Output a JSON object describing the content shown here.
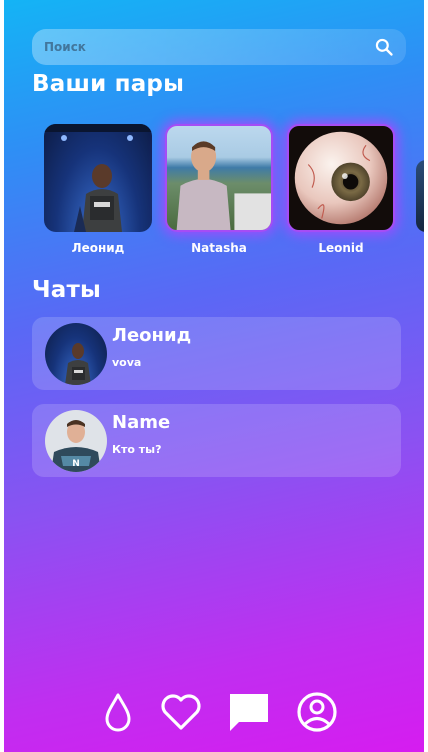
{
  "search": {
    "placeholder": "Поиск",
    "value": "",
    "icon": "search-icon"
  },
  "matches": {
    "title": "Ваши пары",
    "items": [
      {
        "name": "Леонид"
      },
      {
        "name": "Natasha"
      },
      {
        "name": "Leonid"
      }
    ]
  },
  "chats": {
    "title": "Чаты",
    "items": [
      {
        "name": "Леонид",
        "last_message": "vova"
      },
      {
        "name": "Name",
        "last_message": "Кто ты?"
      }
    ]
  },
  "nav": {
    "items": [
      {
        "icon": "drop-icon"
      },
      {
        "icon": "heart-icon"
      },
      {
        "icon": "chat-icon"
      },
      {
        "icon": "profile-icon"
      }
    ]
  },
  "colors": {
    "gradient_top": "#14b4f5",
    "gradient_bottom": "#d61cf0",
    "highlight_border": "#a54df5"
  }
}
